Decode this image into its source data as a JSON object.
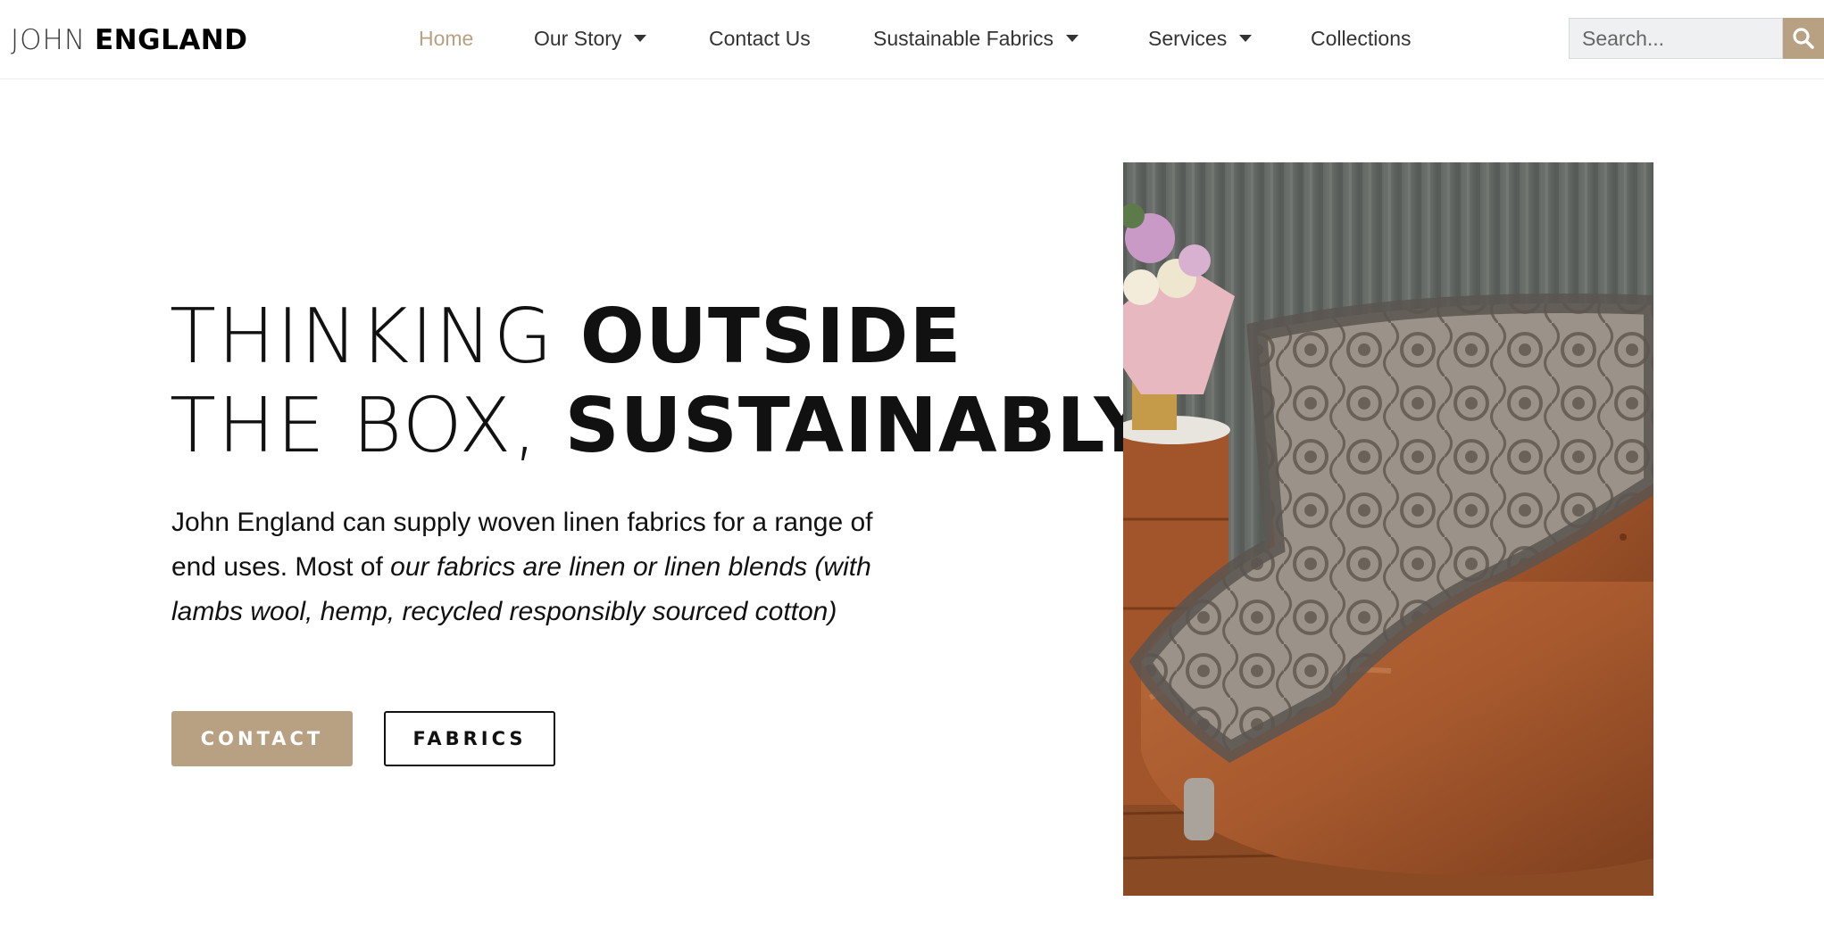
{
  "logo": {
    "first": "JOHN",
    "last": "ENGLAND"
  },
  "nav": {
    "home": "Home",
    "our_story": "Our Story",
    "contact_us": "Contact Us",
    "sustainable_fabrics": "Sustainable Fabrics",
    "services": "Services",
    "collections": "Collections"
  },
  "search": {
    "placeholder": "Search..."
  },
  "hero": {
    "line1_light": "THINKING ",
    "line1_bold": "OUTSIDE",
    "line2_light": "THE BOX, ",
    "line2_bold": "SUSTAINABLY",
    "desc_plain": "John England can supply woven linen fabrics for a range of end uses. Most of ",
    "desc_italic": "our fabrics are linen or linen blends (with lambs wool, hemp, recycled responsibly sourced cotton)",
    "contact_button": "CONTACT",
    "fabrics_button": "FABRICS"
  },
  "colors": {
    "accent": "#b8a183",
    "text": "#111111",
    "nav_text": "#333333"
  },
  "icons": {
    "search": "search-icon",
    "dropdown": "caret-down-icon"
  }
}
